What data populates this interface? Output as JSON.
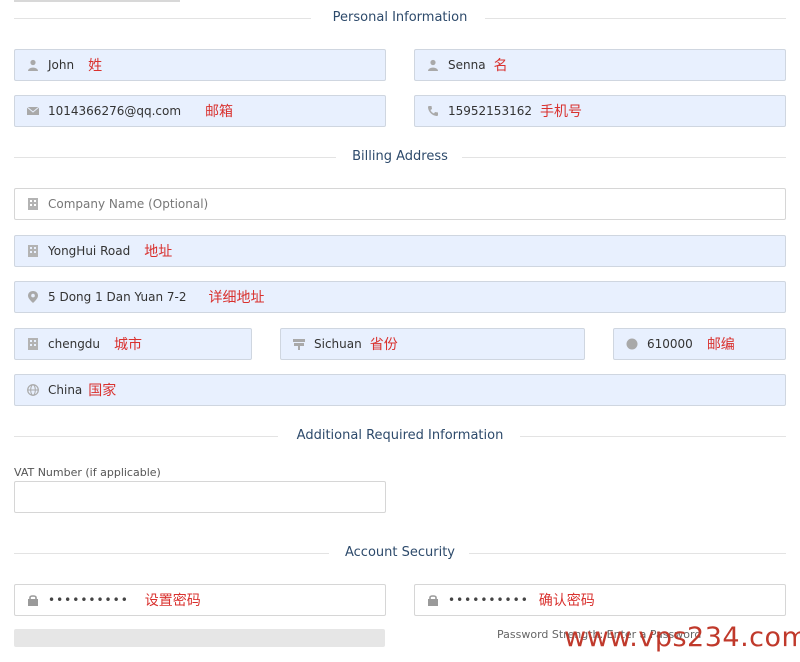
{
  "sections": {
    "personal": "Personal Information",
    "billing": "Billing Address",
    "additional": "Additional Required Information",
    "security": "Account Security"
  },
  "personal": {
    "first_name": {
      "value": "John",
      "note": "姓"
    },
    "last_name": {
      "value": "Senna",
      "note": "名"
    },
    "email": {
      "value": "1014366276@qq.com",
      "note": "邮箱"
    },
    "phone": {
      "value": "15952153162",
      "note": "手机号"
    }
  },
  "billing": {
    "company": {
      "placeholder": "Company Name (Optional)"
    },
    "address1": {
      "value": "YongHui Road",
      "note": "地址"
    },
    "address2": {
      "value": "5 Dong 1 Dan Yuan 7-2",
      "note": "详细地址"
    },
    "city": {
      "value": "chengdu",
      "note": "城市"
    },
    "state": {
      "value": "Sichuan",
      "note": "省份"
    },
    "postcode": {
      "value": "610000",
      "note": "邮编"
    },
    "country": {
      "value": "China",
      "note": "国家"
    }
  },
  "additional": {
    "vat_label": "VAT Number (if applicable)",
    "vat_value": ""
  },
  "security": {
    "password": {
      "value": "••••••••••",
      "note": "设置密码"
    },
    "confirm": {
      "value": "••••••••••",
      "note": "确认密码"
    },
    "strength_text": "Password Strength: Enter a Password"
  },
  "watermark": "www.vps234.com",
  "icons": {
    "user": "user-icon",
    "email": "envelope-icon",
    "phone": "phone-icon",
    "building": "building-icon",
    "map": "map-marker-icon",
    "state": "signpost-icon",
    "postcode": "certificate-icon",
    "globe": "globe-icon",
    "lock": "lock-icon"
  },
  "colors": {
    "field_bg": "#e8f0fe",
    "section_title": "#2d4a6b",
    "note_red": "#d9312e"
  }
}
